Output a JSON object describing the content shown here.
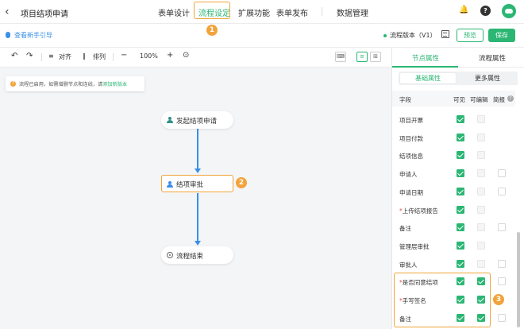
{
  "header": {
    "back_icon": "chevron-left-icon",
    "title": "项目结项申请",
    "tabs": [
      {
        "label": "表单设计",
        "active": false
      },
      {
        "label": "流程设定",
        "active": true
      },
      {
        "label": "扩展功能",
        "active": false
      },
      {
        "label": "表单发布",
        "active": false
      },
      {
        "label": "数据管理",
        "active": false
      }
    ],
    "step_badge_1": "1",
    "icons": [
      "bell-icon",
      "help-icon",
      "avatar-cloud-icon"
    ],
    "help_glyph": "?"
  },
  "guide": {
    "link_text": "查看新手引导",
    "version_text": "流程版本（V1）",
    "preview_label": "预览",
    "save_label": "保存"
  },
  "toolbar": {
    "undo_glyph": "↶",
    "redo_glyph": "↷",
    "align_label": "对齐",
    "arrange_label": "排列",
    "zoom_out_glyph": "−",
    "zoom_level": "100%",
    "zoom_in_glyph": "+",
    "locate_glyph": "⊙"
  },
  "canvas": {
    "notice_text": "流程已启用，如需增删节点和连线，请",
    "notice_link": "添加新版本",
    "notice_glyph": "!",
    "nodes": [
      {
        "label": "发起结项申请",
        "icon": "user-icon"
      },
      {
        "label": "结项审批",
        "icon": "approver-icon"
      },
      {
        "label": "流程结束",
        "icon": "end-icon"
      }
    ],
    "step_badge_2": "2"
  },
  "panel": {
    "tabs": [
      {
        "label": "节点属性",
        "active": true
      },
      {
        "label": "流程属性",
        "active": false
      }
    ],
    "sub_tabs": [
      {
        "label": "基础属性",
        "active": true
      },
      {
        "label": "更多属性",
        "active": false
      }
    ],
    "columns": [
      "字段",
      "可见",
      "可编辑",
      "简报"
    ],
    "rows": [
      {
        "field": "项目开票",
        "required": false,
        "visible": "on",
        "editable": "dis",
        "brief": "none"
      },
      {
        "field": "项目付款",
        "required": false,
        "visible": "on",
        "editable": "dis",
        "brief": "none"
      },
      {
        "field": "结项信息",
        "required": false,
        "visible": "on",
        "editable": "dis",
        "brief": "none"
      },
      {
        "field": "申请人",
        "required": false,
        "visible": "on",
        "editable": "dis",
        "brief": "off"
      },
      {
        "field": "申请日期",
        "required": false,
        "visible": "on",
        "editable": "dis",
        "brief": "off"
      },
      {
        "field": "上传结项报告",
        "required": true,
        "visible": "on",
        "editable": "dis",
        "brief": "none"
      },
      {
        "field": "备注",
        "required": false,
        "visible": "on",
        "editable": "dis",
        "brief": "off"
      },
      {
        "field": "管理层审批",
        "required": false,
        "visible": "on",
        "editable": "dis",
        "brief": "none"
      },
      {
        "field": "审批人",
        "required": false,
        "visible": "on",
        "editable": "dis",
        "brief": "off"
      },
      {
        "field": "是否同意结项",
        "required": true,
        "visible": "on",
        "editable": "on",
        "brief": "off"
      },
      {
        "field": "手写签名",
        "required": true,
        "visible": "on",
        "editable": "on",
        "brief": "none"
      },
      {
        "field": "备注",
        "required": false,
        "visible": "on",
        "editable": "on",
        "brief": "off"
      }
    ],
    "step_badge_3": "3",
    "required_mark": "*"
  },
  "colors": {
    "accent": "#2bb673",
    "highlight": "#f2a33a",
    "link_blue": "#3a8fe8"
  }
}
